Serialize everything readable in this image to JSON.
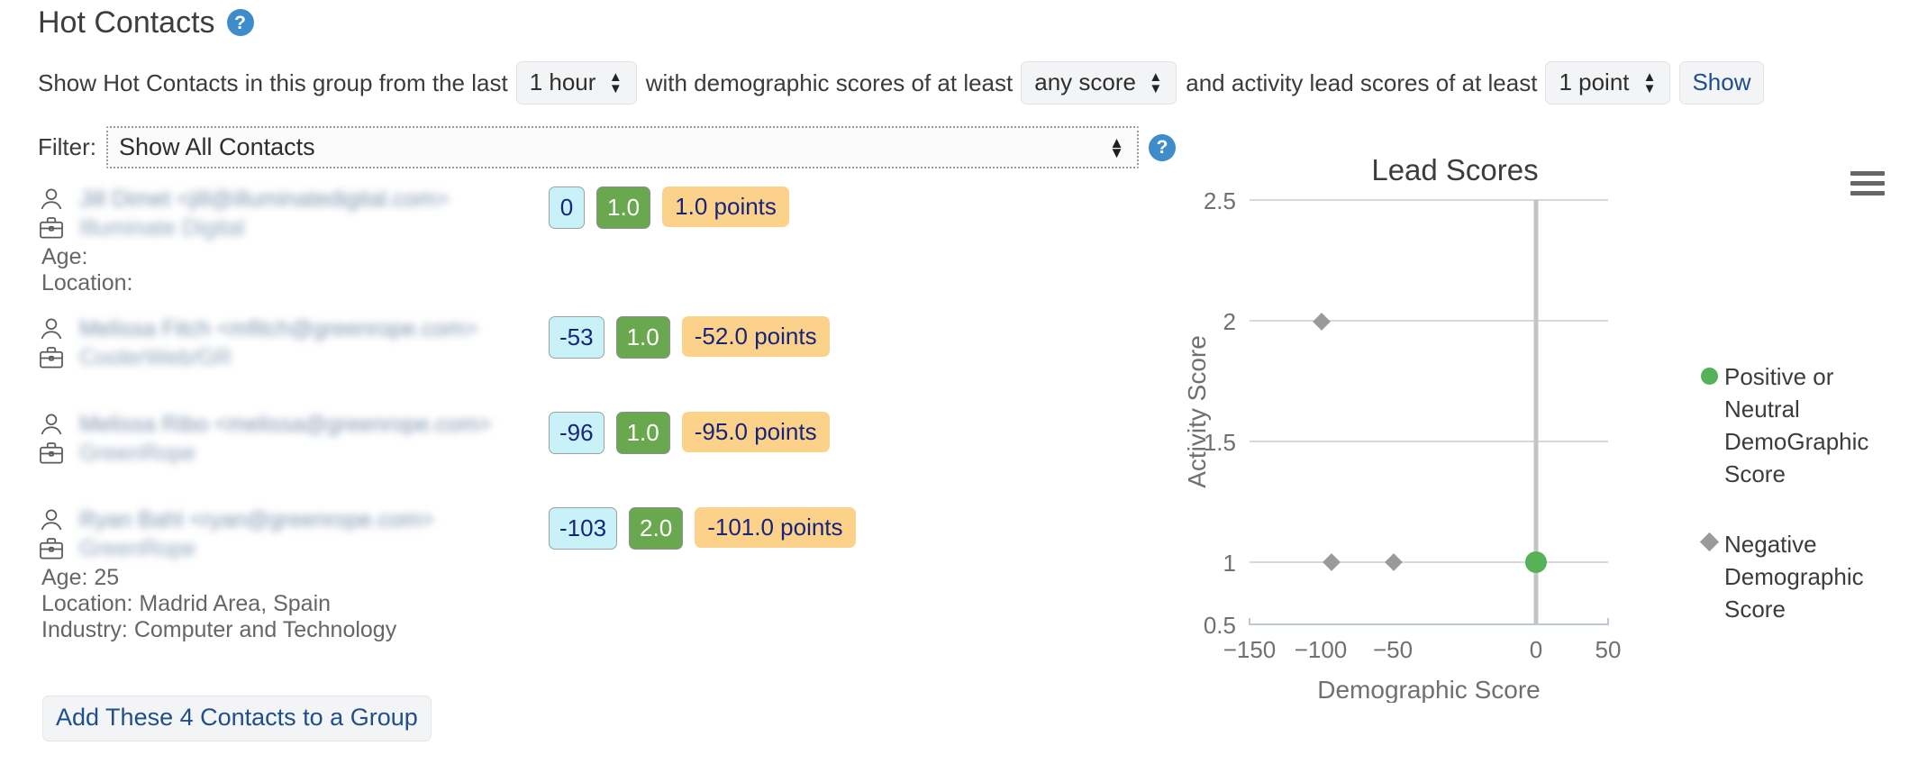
{
  "page": {
    "title": "Hot Contacts",
    "help_icon_glyph": "?"
  },
  "query": {
    "prefix": "Show Hot Contacts in this group from the last",
    "timeframe_value": "1 hour",
    "mid_text": "with demographic scores of at least",
    "demographic_value": "any score",
    "suffix_text": "and activity lead scores of at least",
    "activity_value": "1 point",
    "show_label": "Show"
  },
  "filter": {
    "label": "Filter:",
    "value": "Show All Contacts",
    "help_icon_glyph": "?"
  },
  "contacts": [
    {
      "name_line": "Jill Dimet <jill@illuminatedigital.com>",
      "company_line": "Illuminate Digital",
      "demographic_score": "0",
      "activity_score": "1.0",
      "points": "1.0 points",
      "details": [
        "Age:",
        "Location:"
      ]
    },
    {
      "name_line": "Melissa Fitch <mfitch@greenrope.com>",
      "company_line": "CoolerWeb/GR",
      "demographic_score": "-53",
      "activity_score": "1.0",
      "points": "-52.0 points",
      "details": []
    },
    {
      "name_line": "Melissa Ribo <melissa@greenrope.com>",
      "company_line": "GreenRope",
      "demographic_score": "-96",
      "activity_score": "1.0",
      "points": "-95.0 points",
      "details": []
    },
    {
      "name_line": "Ryan Bahl <ryan@greenrope.com>",
      "company_line": "GreenRope",
      "demographic_score": "-103",
      "activity_score": "2.0",
      "points": "-101.0 points",
      "details": [
        "Age: 25",
        "Location: Madrid Area, Spain",
        "Industry: Computer and Technology"
      ]
    }
  ],
  "add_button": {
    "label": "Add These 4 Contacts to a Group"
  },
  "chart_data": {
    "type": "scatter",
    "title": "Lead Scores",
    "xlabel": "Demographic Score",
    "ylabel": "Activity Score",
    "xlim": [
      -175,
      62
    ],
    "ylim": [
      0.5,
      2.5
    ],
    "xticks": [
      "−150",
      "−100",
      "−50",
      "0",
      "50"
    ],
    "xtick_values": [
      -150,
      -100,
      -50,
      0,
      50
    ],
    "yticks": [
      "0.5",
      "1",
      "1.5",
      "2",
      "2.5"
    ],
    "ytick_values": [
      0.5,
      1,
      1.5,
      2,
      2.5
    ],
    "grid": true,
    "legend_position": "right",
    "series": [
      {
        "name": "Positive or Neutral DemoGraphic Score",
        "marker": "circle",
        "color": "#55b257",
        "points": [
          {
            "x": 0,
            "y": 1
          }
        ]
      },
      {
        "name": "Negative Demographic Score",
        "marker": "diamond",
        "color": "#9a9a9a",
        "points": [
          {
            "x": -103,
            "y": 2
          },
          {
            "x": -96,
            "y": 1
          },
          {
            "x": -53,
            "y": 1
          }
        ]
      }
    ],
    "menu_icon": "hamburger-icon"
  },
  "colors": {
    "accent_blue": "#3f8ccb",
    "link_blue": "#1f4e8c",
    "badge_demographic_bg": "#c8f2f8",
    "badge_activity_bg": "#6aa84f",
    "badge_points_bg": "#fcd28a",
    "marker_green": "#55b257",
    "marker_gray": "#9a9a9a"
  }
}
